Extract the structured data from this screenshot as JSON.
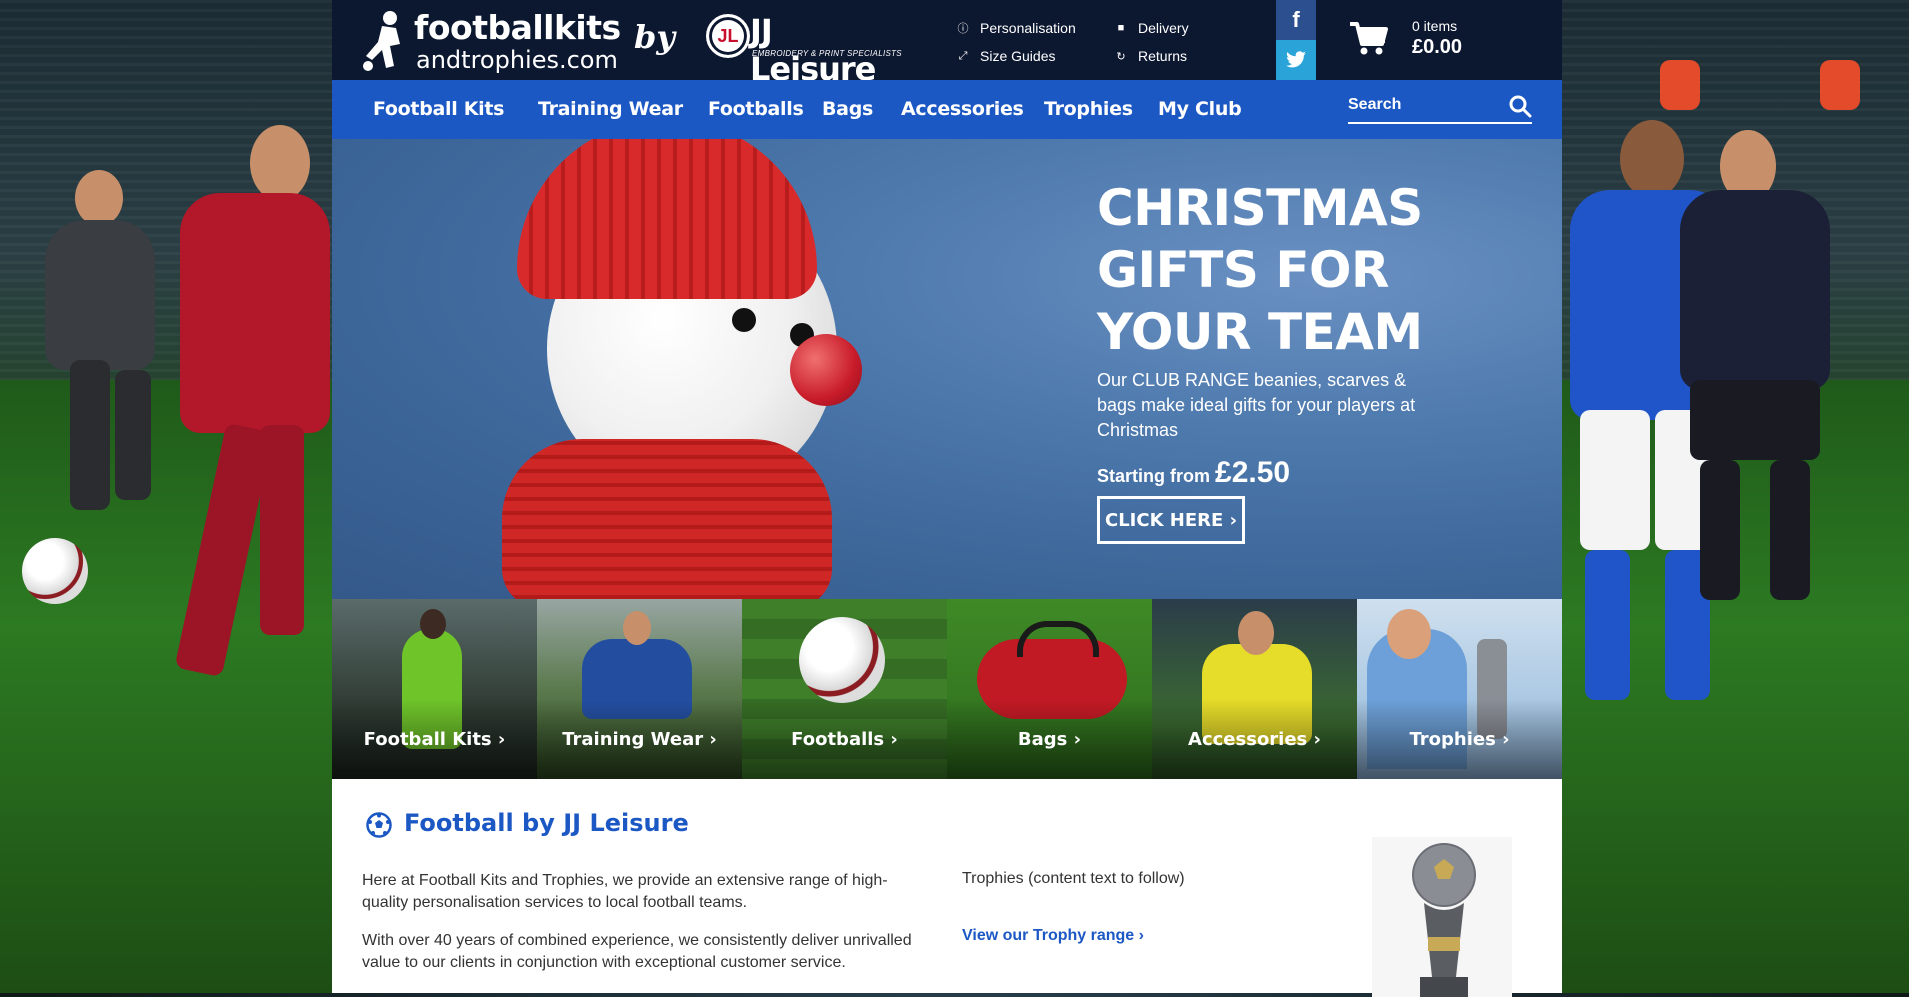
{
  "header": {
    "logo_line1": "footballkits",
    "logo_line2": "andtrophies.com",
    "logo_by": "by",
    "jj_badge": "JL",
    "jj_name": "JJ Leisure",
    "jj_tagline": "EMBROIDERY & PRINT SPECIALISTS",
    "utility_links": [
      {
        "label": "Personalisation",
        "icon": "info-icon"
      },
      {
        "label": "Size Guides",
        "icon": "resize-icon"
      },
      {
        "label": "Delivery",
        "icon": "truck-icon"
      },
      {
        "label": "Returns",
        "icon": "refresh-icon"
      }
    ],
    "social": {
      "facebook": "f",
      "twitter": "t"
    },
    "cart": {
      "items": "0 items",
      "total": "£0.00",
      "icon": "cart-icon"
    }
  },
  "nav": {
    "items": [
      "Football Kits",
      "Training Wear",
      "Footballs",
      "Bags",
      "Accessories",
      "Trophies",
      "My Club"
    ],
    "search_placeholder": "Search"
  },
  "hero": {
    "title": "CHRISTMAS GIFTS FOR YOUR TEAM",
    "text": "Our CLUB RANGE beanies, scarves & bags make ideal gifts for your players at Christmas",
    "price_prefix": "Starting from",
    "price": "£2.50",
    "button": "CLICK HERE ›"
  },
  "tiles": [
    {
      "label": "Football Kits ›"
    },
    {
      "label": "Training Wear ›"
    },
    {
      "label": "Footballs ›"
    },
    {
      "label": "Bags ›"
    },
    {
      "label": "Accessories ›"
    },
    {
      "label": "Trophies ›"
    }
  ],
  "content": {
    "heading": "Football by JJ Leisure",
    "para1": "Here at Football Kits and Trophies, we provide an extensive range of high-quality personalisation services to local football teams.",
    "para2": "With over 40 years of combined experience, we consistently deliver unrivalled value to our clients in conjunction with exceptional customer service.",
    "trophy_text": "Trophies (content text to follow)",
    "trophy_link": "View our Trophy range  ›"
  },
  "colors": {
    "topbar": "#0c1730",
    "nav": "#1c58c4",
    "facebook": "#2c4f8f",
    "twitter": "#2aa3d9",
    "link": "#1c58c4"
  }
}
